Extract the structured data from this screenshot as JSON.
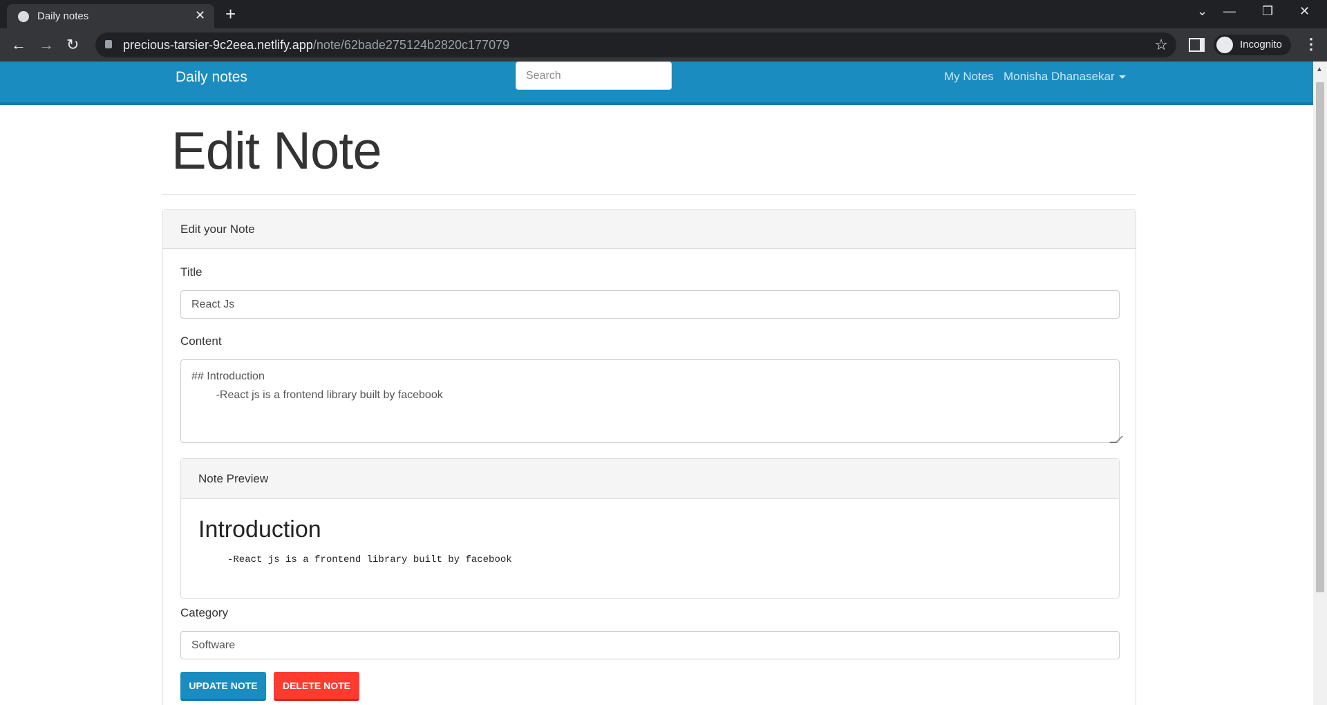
{
  "browser": {
    "tab_title": "Daily notes",
    "tab_close": "✕",
    "new_tab": "+",
    "url_host": "precious-tarsier-9c2eea.netlify.app",
    "url_path": "/note/62bade275124b2820c177079",
    "incognito_label": "Incognito",
    "back": "←",
    "forward": "→",
    "reload": "↻",
    "star": "☆",
    "menu": "⋮",
    "win_list": "⌄",
    "win_min": "—",
    "win_max": "❐",
    "win_close": "✕"
  },
  "navbar": {
    "brand": "Daily notes",
    "search_placeholder": "Search",
    "my_notes": "My Notes",
    "user_name": "Monisha Dhanasekar"
  },
  "page": {
    "title": "Edit Note"
  },
  "form": {
    "header": "Edit your Note",
    "title_label": "Title",
    "title_value": "React Js",
    "content_label": "Content",
    "content_value": "## Introduction\n        -React js is a frontend library built by facebook",
    "preview_header": "Note Preview",
    "preview_heading": "Introduction",
    "preview_code": "-React js is a frontend library built by facebook",
    "category_label": "Category",
    "category_value": "Software",
    "update_button": "UPDATE NOTE",
    "delete_button": "DELETE NOTE"
  },
  "colors": {
    "navbar": "#1a8cbf",
    "update_button": "#1a8cbf",
    "delete_button": "#ff3b30"
  }
}
